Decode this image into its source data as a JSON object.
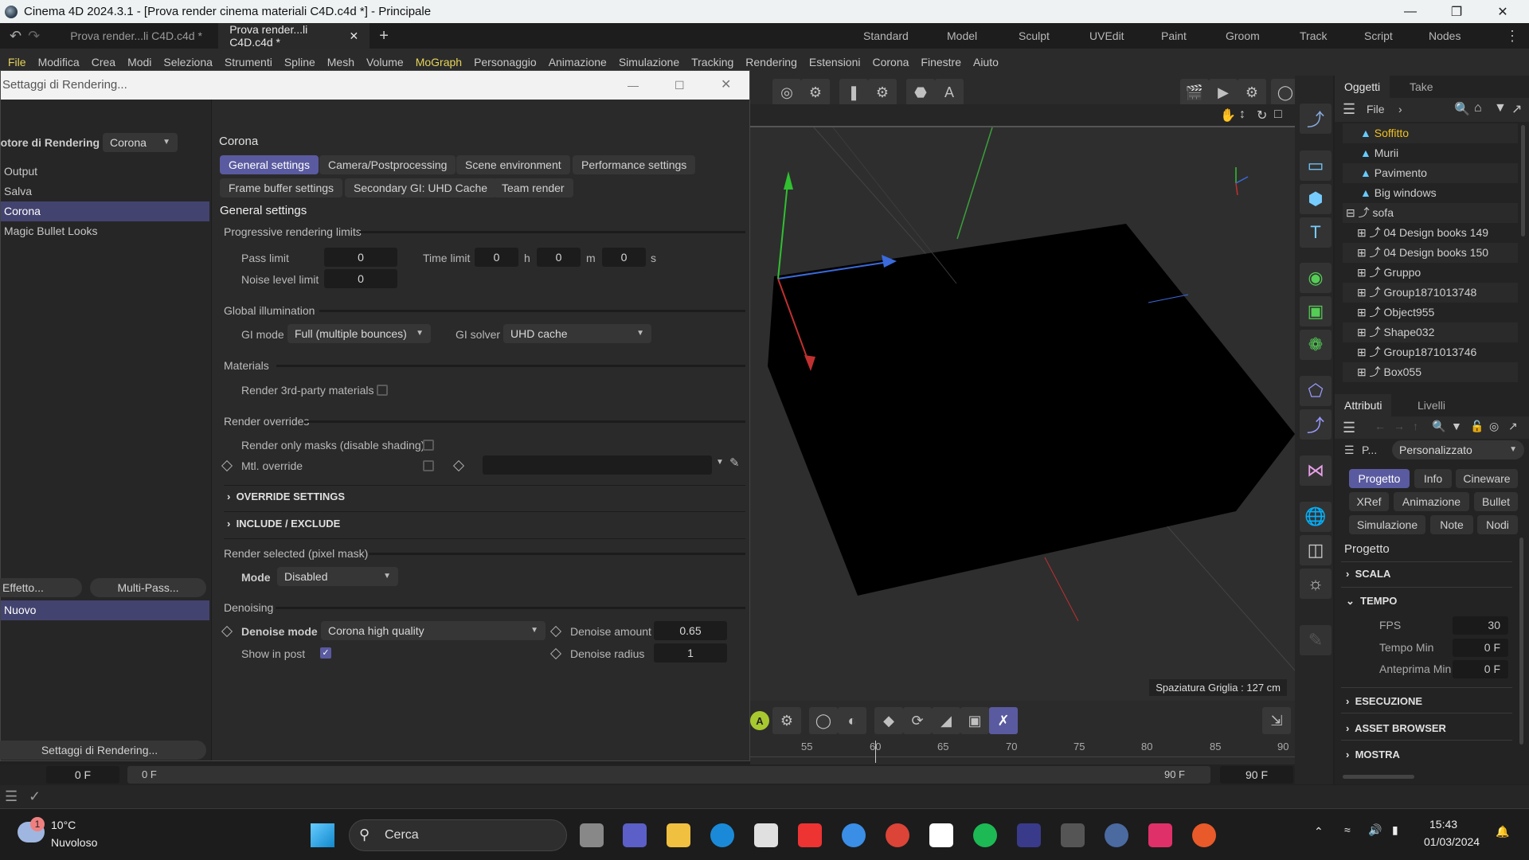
{
  "window": {
    "title": "Cinema 4D 2024.3.1 - [Prova render cinema materiali C4D.c4d *] - Principale",
    "controls": [
      "minimize",
      "maximize",
      "close"
    ]
  },
  "tabs": [
    {
      "label": "Prova render...li C4D.c4d *",
      "active": false
    },
    {
      "label": "Prova render...li C4D.c4d *",
      "active": true
    }
  ],
  "layouts": [
    "Standard",
    "Model",
    "Sculpt",
    "UVEdit",
    "Paint",
    "Groom",
    "Track",
    "Script",
    "Nodes"
  ],
  "menu": [
    "File",
    "Modifica",
    "Crea",
    "Modi",
    "Seleziona",
    "Strumenti",
    "Spline",
    "Mesh",
    "Volume",
    "MoGraph",
    "Personaggio",
    "Animazione",
    "Simulazione",
    "Tracking",
    "Rendering",
    "Estensioni",
    "Corona",
    "Finestre",
    "Aiuto"
  ],
  "dialog": {
    "title": "Settaggi di Rendering...",
    "renderer_label": "Motore di Rendering",
    "renderer_value": "Corona",
    "left_items": [
      "Output",
      "Salva",
      "Corona",
      "Magic Bullet Looks"
    ],
    "left_selected": "Corona",
    "effect_button": "Effetto...",
    "multipass_button": "Multi-Pass...",
    "preset_item": "Nuovo",
    "settings_button": "Settaggi di Rendering...",
    "header": "Corona",
    "section_tabs": [
      "General settings",
      "Camera/Postprocessing",
      "Scene environment",
      "Performance settings",
      "Frame buffer settings",
      "Secondary GI: UHD Cache",
      "Team render"
    ],
    "active_tab": "General settings",
    "section_title": "General settings",
    "progressive": {
      "group": "Progressive rendering limits",
      "pass_limit_label": "Pass limit",
      "pass_limit": "0",
      "time_limit_label": "Time limit",
      "h": "0",
      "m": "0",
      "s": "0",
      "h_unit": "h",
      "m_unit": "m",
      "s_unit": "s",
      "noise_label": "Noise level limit",
      "noise": "0"
    },
    "gi": {
      "group": "Global illumination",
      "mode_label": "GI mode",
      "mode": "Full (multiple bounces)",
      "solver_label": "GI solver",
      "solver": "UHD cache"
    },
    "materials": {
      "group": "Materials",
      "third_party_label": "Render 3rd-party materials",
      "third_party": false
    },
    "overrides": {
      "group": "Render overrides",
      "masks_label": "Render only masks (disable shading)",
      "masks": false,
      "mtl_label": "Mtl. override",
      "mtl": false,
      "mtl_value": ""
    },
    "folds": [
      "OVERRIDE SETTINGS",
      "INCLUDE / EXCLUDE"
    ],
    "pixel_mask": {
      "group": "Render selected (pixel mask)",
      "mode_label": "Mode",
      "mode": "Disabled"
    },
    "denoising": {
      "group": "Denoising",
      "mode_label": "Denoise mode",
      "mode": "Corona high quality",
      "amount_label": "Denoise amount",
      "amount": "0.65",
      "radius_label": "Denoise radius",
      "radius": "1",
      "show_post_label": "Show in post",
      "show_post": true
    }
  },
  "viewport": {
    "grid_label": "Spaziatura Griglia : 127 cm"
  },
  "objects": {
    "tabs": [
      "Oggetti",
      "Take"
    ],
    "file_label": "File",
    "items": [
      {
        "name": "Soffitto",
        "type": "polygon",
        "highlight": true,
        "indent": 0
      },
      {
        "name": "Murii",
        "type": "polygon",
        "indent": 0
      },
      {
        "name": "Pavimento",
        "type": "polygon",
        "indent": 0
      },
      {
        "name": "Big windows",
        "type": "polygon",
        "indent": 0
      },
      {
        "name": "sofa",
        "type": "null",
        "indent": 0,
        "expanded": true
      },
      {
        "name": "04 Design books 149",
        "type": "null",
        "indent": 1
      },
      {
        "name": "04 Design books 150",
        "type": "null",
        "indent": 1
      },
      {
        "name": "Gruppo",
        "type": "null",
        "indent": 1
      },
      {
        "name": "Group1871013748",
        "type": "null",
        "indent": 1
      },
      {
        "name": "Object955",
        "type": "null",
        "indent": 1
      },
      {
        "name": "Shape032",
        "type": "null",
        "indent": 1
      },
      {
        "name": "Group1871013746",
        "type": "null",
        "indent": 1
      },
      {
        "name": "Box055",
        "type": "null",
        "indent": 1
      }
    ]
  },
  "attributes": {
    "tabs": [
      "Attributi",
      "Livelli"
    ],
    "mode_short": "P...",
    "mode_value": "Personalizzato",
    "buttons": [
      "Progetto",
      "Info",
      "Cineware",
      "XRef",
      "Animazione",
      "Bullet",
      "Simulazione",
      "Note",
      "Nodi"
    ],
    "active_button": "Progetto",
    "title": "Progetto",
    "sections": {
      "scala": "SCALA",
      "tempo": "TEMPO",
      "esecuzione": "ESECUZIONE",
      "asset": "ASSET BROWSER",
      "mostra": "MOSTRA"
    },
    "fps_label": "FPS",
    "fps": "30",
    "tmin_label": "Tempo Min",
    "tmin": "0 F",
    "pmin_label": "Anteprima Min",
    "pmin": "0 F"
  },
  "timeline": {
    "ticks": [
      "55",
      "60",
      "65",
      "70",
      "75",
      "80",
      "85",
      "90"
    ],
    "start": "0 F",
    "current": "0 F",
    "end_a": "90 F",
    "end_b": "90 F"
  },
  "taskbar": {
    "weather_temp": "10°C",
    "weather_desc": "Nuvoloso",
    "weather_badge": "1",
    "search": "Cerca",
    "time": "15:43",
    "date": "01/03/2024"
  }
}
